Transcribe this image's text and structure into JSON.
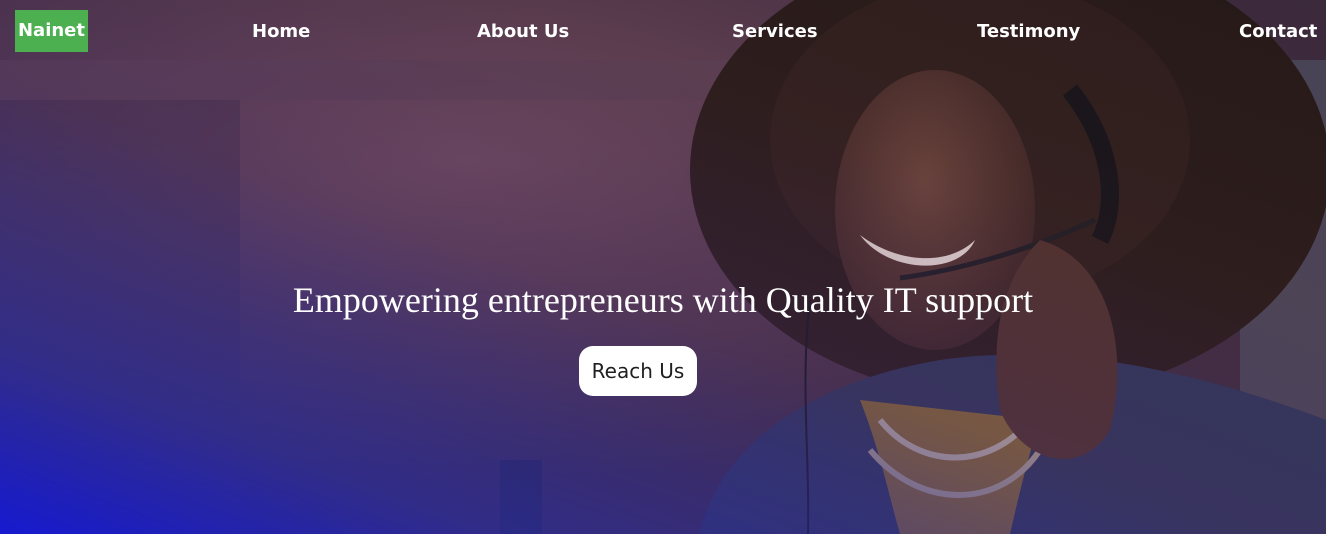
{
  "brand": {
    "label": "Nainet",
    "color": "#4caf50"
  },
  "nav": {
    "items": [
      {
        "label": "Home"
      },
      {
        "label": "About Us"
      },
      {
        "label": "Services"
      },
      {
        "label": "Testimony"
      },
      {
        "label": "Contact"
      }
    ]
  },
  "hero": {
    "headline": "Empowering entrepreneurs with Quality IT support",
    "cta_label": "Reach Us",
    "overlay_color": "#1419d7"
  }
}
